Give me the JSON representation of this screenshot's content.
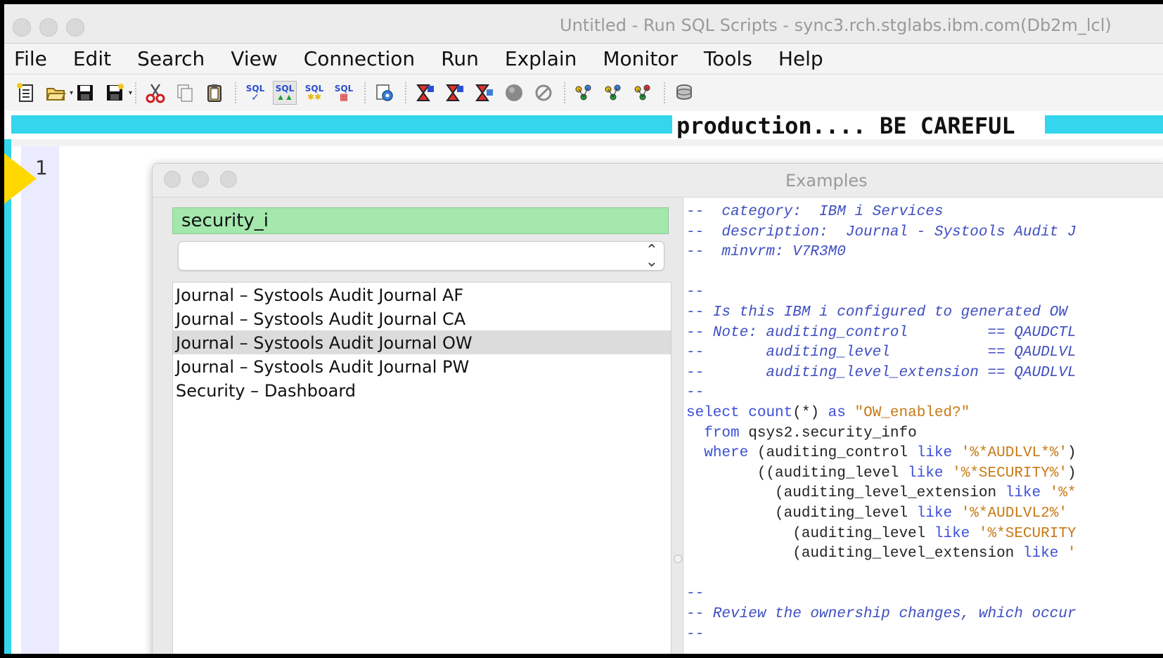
{
  "window": {
    "title": "Untitled - Run SQL Scripts - sync3.rch.stglabs.ibm.com(Db2m_lcl)"
  },
  "menu": {
    "items": [
      "File",
      "Edit",
      "Search",
      "View",
      "Connection",
      "Run",
      "Explain",
      "Monitor",
      "Tools",
      "Help"
    ]
  },
  "toolbar": {
    "sql_label": "SQL"
  },
  "banner": {
    "text": "production.... BE CAREFUL"
  },
  "editor": {
    "line_number": "1"
  },
  "dialog": {
    "title": "Examples",
    "filter_value": "security_i",
    "combo_value": "",
    "list_items": [
      "Journal – Systools Audit Journal AF",
      "Journal – Systools Audit Journal CA",
      "Journal – Systools Audit Journal OW",
      "Journal – Systools Audit Journal PW",
      "Security – Dashboard"
    ],
    "selected_index": 2,
    "code_lines": [
      "--  category:  IBM i Services",
      "--  description:  Journal - Systools Audit J",
      "--  minvrm: V7R3M0",
      "",
      "--",
      "-- Is this IBM i configured to generated OW",
      "-- Note: auditing_control         == QAUDCTL",
      "--       auditing_level           == QAUDLVL",
      "--       auditing_level_extension == QAUDLVL",
      "--",
      "select count(*) as \"OW_enabled?\"",
      "  from qsys2.security_info",
      "  where (auditing_control like '%*AUDLVL*%')",
      "        ((auditing_level like '%*SECURITY%')",
      "          (auditing_level_extension like '%*",
      "          (auditing_level like '%*AUDLVL2%' ",
      "            (auditing_level like '%*SECURITY",
      "            (auditing_level_extension like '",
      "",
      "--",
      "-- Review the ownership changes, which occur",
      "--"
    ]
  }
}
